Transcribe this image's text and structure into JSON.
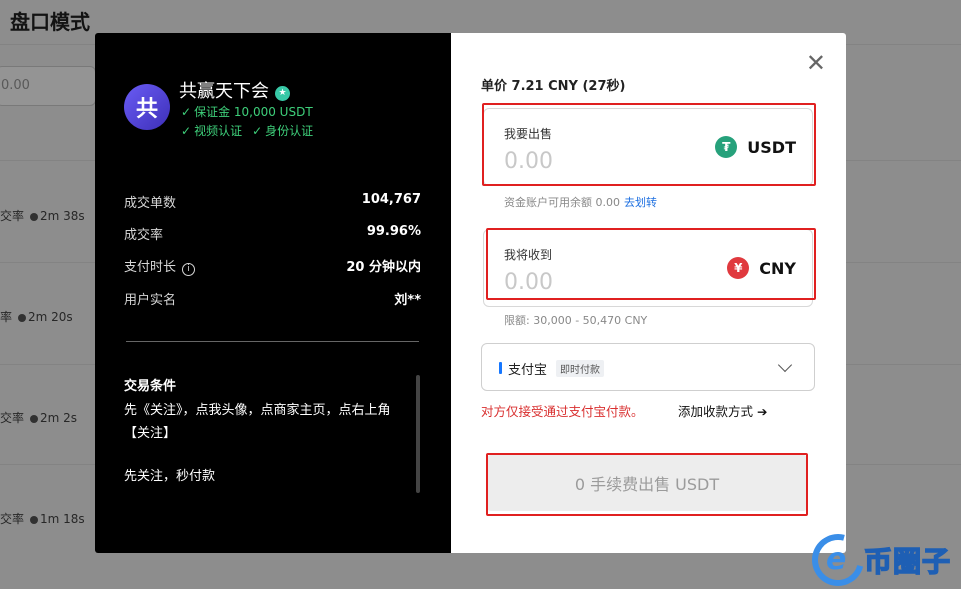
{
  "background": {
    "page_title": "盘口模式",
    "input_value": "0.00",
    "rows": [
      {
        "rate_label": "交率",
        "time": "2m 38s"
      },
      {
        "rate_label": "率",
        "time": "2m 20s"
      },
      {
        "rate_label": "交率",
        "time": "2m 2s"
      },
      {
        "rate_label": "交率",
        "time": "1m 18s"
      }
    ]
  },
  "merchant": {
    "avatar_text": "共",
    "name": "共赢天下会",
    "deposit": "保证金 10,000 USDT",
    "video_verified": "视频认证",
    "id_verified": "身份认证"
  },
  "stats": [
    {
      "label": "成交单数",
      "value": "104,767"
    },
    {
      "label": "成交率",
      "value": "99.96%"
    },
    {
      "label": "支付时长",
      "value": "20 分钟以内"
    },
    {
      "label": "用户实名",
      "value": "刘**"
    }
  ],
  "terms": {
    "title": "交易条件",
    "text": "先《关注》，点我头像，点商家主页，点右上角【关注】",
    "text2": "先关注，秒付款"
  },
  "order": {
    "price_line": "单价 7.21 CNY (27秒)",
    "sell": {
      "label": "我要出售",
      "value": "0.00",
      "currency": "USDT",
      "coin_glyph": "₮"
    },
    "balance_note": "资金账户可用余额 0.00",
    "transfer_link": "去划转",
    "receive": {
      "label": "我将收到",
      "value": "0.00",
      "currency": "CNY",
      "coin_glyph": "¥"
    },
    "limit_note": "限额: 30,000 - 50,470 CNY",
    "payment_method": "支付宝",
    "payment_tag": "即时付款",
    "warning": "对方仅接受通过支付宝付款。",
    "add_method": "添加收款方式 ➔",
    "submit_label": "0 手续费出售 USDT"
  },
  "watermark": {
    "text": "币圈子"
  },
  "colors": {
    "accent_green": "#3ecf7a",
    "warning_red": "#d93030",
    "link_blue": "#1d6fe0",
    "frame_red": "#e02020"
  }
}
